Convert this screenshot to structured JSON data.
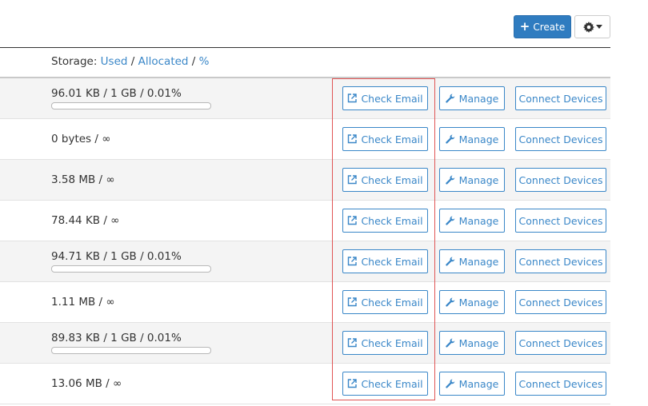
{
  "toolbar": {
    "create_label": "Create",
    "create_icon": "plus-icon",
    "settings_icon": "gear-icon",
    "accent": "#2f7cc0"
  },
  "storage_header": {
    "label": "Storage:",
    "used": "Used",
    "sep1": "/",
    "allocated": "Allocated",
    "sep2": "/",
    "percent": "%"
  },
  "actions": {
    "check_email": "Check Email",
    "manage": "Manage",
    "connect_devices": "Connect Devices"
  },
  "rows": [
    {
      "usage": "96.01 KB / 1 GB / 0.01%",
      "fraction": 0.0001
    },
    {
      "usage": "0 bytes / ∞"
    },
    {
      "usage": "3.58 MB / ∞"
    },
    {
      "usage": "78.44 KB / ∞"
    },
    {
      "usage": "94.71 KB / 1 GB / 0.01%",
      "fraction": 0.0001
    },
    {
      "usage": "1.11 MB / ∞"
    },
    {
      "usage": "89.83 KB / 1 GB / 0.01%",
      "fraction": 0.0001
    },
    {
      "usage": "13.06 MB / ∞"
    }
  ]
}
